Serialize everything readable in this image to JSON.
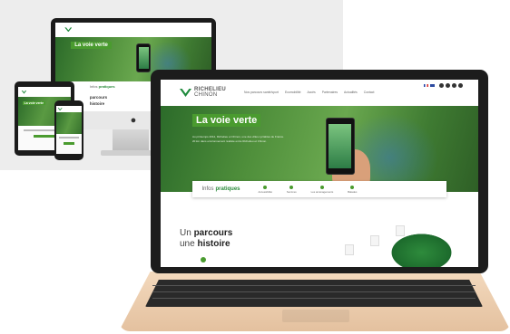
{
  "site": {
    "logo": {
      "line1": "RICHELIEU",
      "line2": "CHINON"
    },
    "nav": [
      "Nos parcours santé/sport",
      "Ecomobilité",
      "Accès",
      "Partenaires",
      "Actualités",
      "Contact"
    ],
    "hero": {
      "title": "La voie verte",
      "paragraph": "Au printemps 2012, Richelieu et Chinon, une des villes cyclables de France. 20 km dans environnement réaliste entre Richelieu et Chinon."
    },
    "info_bar": {
      "label_light": "Infos",
      "label_bold": "pratiques",
      "items": [
        "Accessibilité",
        "Services",
        "Les aménagements",
        "Balades"
      ]
    },
    "lower": {
      "l1_light": "Un",
      "l1_bold": "parcours",
      "l2_light": "une",
      "l2_bold": "histoire"
    }
  },
  "monitor_site": {
    "hero_title": "La voie verte",
    "info_label_light": "Infos",
    "info_label_bold": "pratiques",
    "lower_l1": "parcours",
    "lower_l2": "histoire"
  },
  "tablet_site": {
    "hero_title": "La voie verte",
    "lower_l1": "Un parcours",
    "lower_l2": "une histoire"
  },
  "colors": {
    "brand_green": "#4a9b2f",
    "dark_green": "#1e8a3c",
    "laptop_gold": "#e4c19f"
  },
  "icons": {
    "apple_logo": "apple-logo-icon",
    "arrow": "arrow-right-icon"
  }
}
